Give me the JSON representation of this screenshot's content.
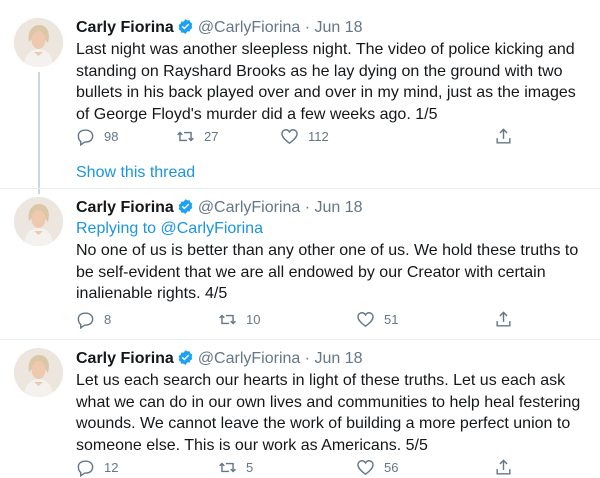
{
  "tweets": [
    {
      "name": "Carly Fiorina",
      "handle": "@CarlyFiorina",
      "date": "· Jun 18",
      "replying_to": "",
      "text": "Last night was another sleepless night. The video of police kicking and standing on Rayshard Brooks as he lay dying on the ground with two bullets in his back played over and over in my mind, just as the images of George Floyd's murder did a few weeks ago. 1/5",
      "replies": "98",
      "retweets": "27",
      "likes": "112"
    },
    {
      "name": "Carly Fiorina",
      "handle": "@CarlyFiorina",
      "date": "· Jun 18",
      "replying_to": "Replying to @CarlyFiorina",
      "text": "No one of us is better than any other one of us. We hold these truths to be self-evident that we are all endowed by our Creator with certain inalienable rights. 4/5",
      "replies": "8",
      "retweets": "10",
      "likes": "51"
    },
    {
      "name": "Carly Fiorina",
      "handle": "@CarlyFiorina",
      "date": "· Jun 18",
      "replying_to": "",
      "text": "Let us each search our hearts in light of these truths. Let us each ask what we can do in our own lives and communities to help heal festering wounds. We cannot leave the work of building a more perfect union to someone else. This is our work as Americans. 5/5",
      "replies": "12",
      "retweets": "5",
      "likes": "56"
    }
  ],
  "show_thread_label": "Show this thread",
  "icons": [
    "avatar",
    "verified-badge-icon",
    "reply-icon",
    "retweet-icon",
    "like-icon",
    "share-icon"
  ],
  "colors": {
    "accent": "#1b95e0",
    "muted": "#657786",
    "text": "#14171a"
  }
}
